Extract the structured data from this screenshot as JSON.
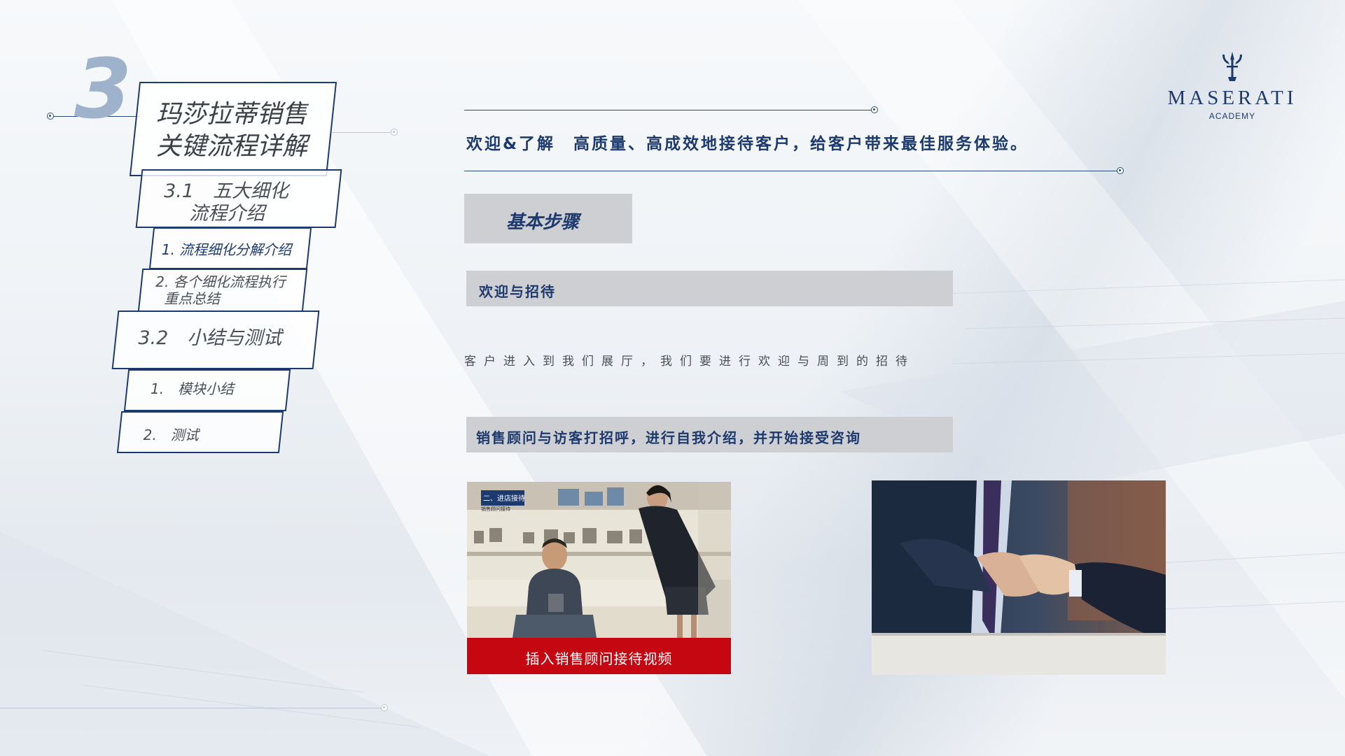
{
  "section_number": "3",
  "nav": {
    "title": "玛莎拉蒂销售关键流程详解",
    "title_line1": "玛莎拉蒂销售",
    "title_line2": "关键流程详解",
    "s31_line1": "3.1　五大细化",
    "s31_line2": "流程介绍",
    "item1": "1. 流程细化分解介绍",
    "item2_line1": "2. 各个细化流程执行",
    "item2_line2": "重点总结",
    "s32": "3.2　小结与测试",
    "m1": "1.　模块小结",
    "m2": "2.　测试"
  },
  "logo": {
    "brand": "MASERATI",
    "sub": "ACADEMY",
    "icon": "trident-icon"
  },
  "headline": "欢迎&了解　高质量、高成效地接待客户，给客户带来最佳服务体验。",
  "steps_label": "基本步骤",
  "step1": "欢迎与招待",
  "step1_desc": "客户进入到我们展厅，我们要进行欢迎与周到的招待",
  "step2": "销售顾问与访客打招呼，进行自我介绍，并开始接受咨询",
  "video_caption": "插入销售顾问接待视频",
  "video_chip": "二、进店接待",
  "video_chip_sub": "销售顾问接待",
  "colors": {
    "navy": "#1d3a6e",
    "bar_gray": "#cdcfd2",
    "video_red": "#c40710",
    "number": "#9fb2cc"
  }
}
